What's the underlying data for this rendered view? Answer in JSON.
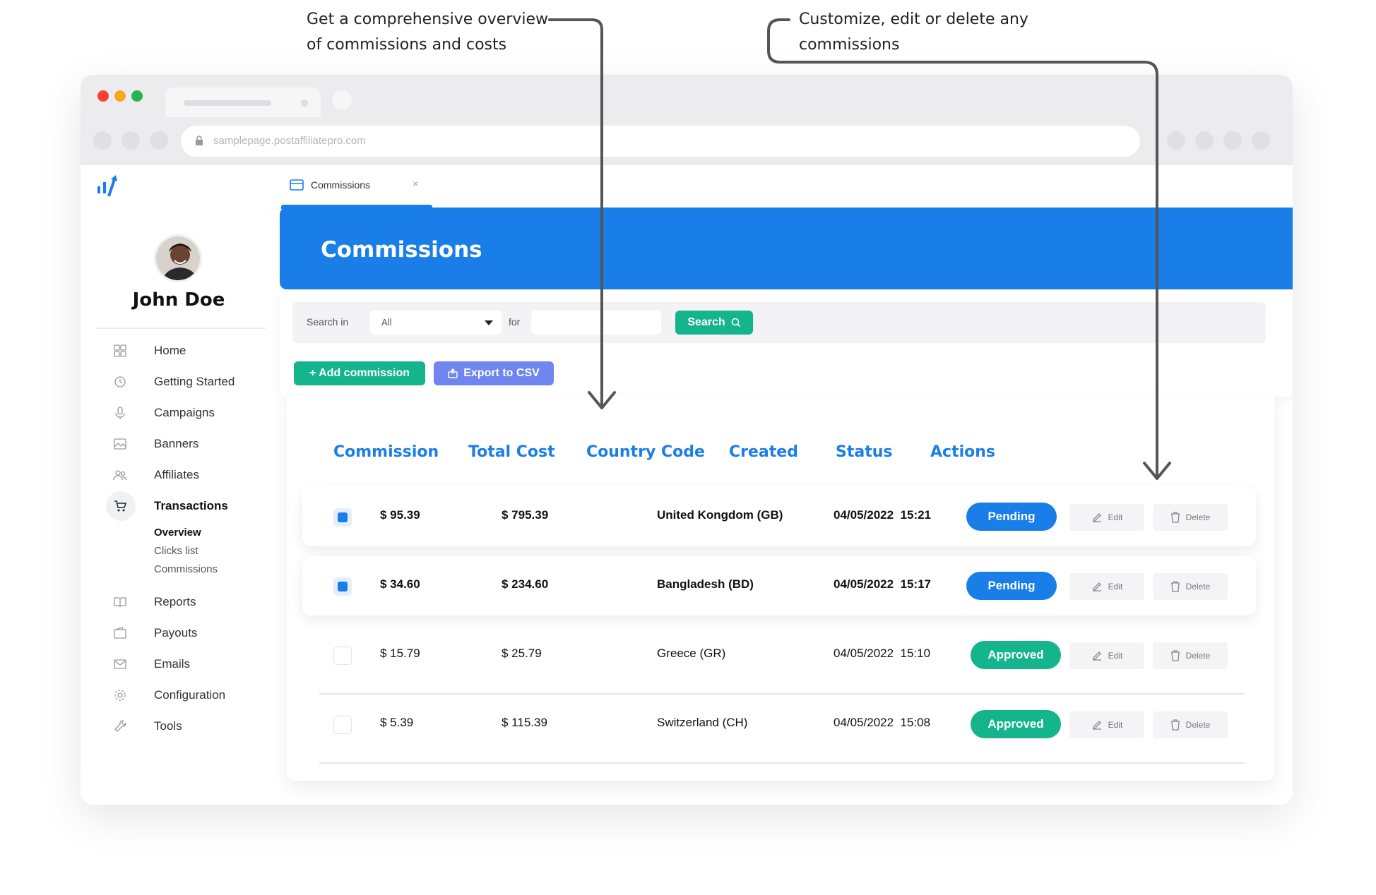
{
  "annotations": {
    "left": "Get a comprehensive overview of commissions and costs",
    "right": "Customize, edit or delete any commissions"
  },
  "browser": {
    "url": "samplepage.postaffiliatepro.com"
  },
  "app": {
    "tab_label": "Commissions",
    "tab_close": "×"
  },
  "user": {
    "name": "John Doe"
  },
  "sidebar": {
    "items": [
      {
        "label": "Home",
        "icon": "grid-icon"
      },
      {
        "label": "Getting Started",
        "icon": "clock-icon"
      },
      {
        "label": "Campaigns",
        "icon": "mic-icon"
      },
      {
        "label": "Banners",
        "icon": "image-icon"
      },
      {
        "label": "Affiliates",
        "icon": "users-icon"
      },
      {
        "label": "Transactions",
        "icon": "cart-icon"
      },
      {
        "label": "Reports",
        "icon": "book-icon"
      },
      {
        "label": "Payouts",
        "icon": "wallet-icon"
      },
      {
        "label": "Emails",
        "icon": "mail-icon"
      },
      {
        "label": "Configuration",
        "icon": "gear-icon"
      },
      {
        "label": "Tools",
        "icon": "wrench-icon"
      }
    ],
    "sub_items": [
      "Overview",
      "Clicks list",
      "Commissions"
    ]
  },
  "page": {
    "title": "Commissions"
  },
  "filter": {
    "search_in_label": "Search in",
    "select_value": "All",
    "for_label": "for",
    "search_button": "Search",
    "add_button": "+ Add commission",
    "export_button": "Export to CSV"
  },
  "table": {
    "headers": [
      "Commission",
      "Total Cost",
      "Country Code",
      "Created",
      "Status",
      "Actions"
    ],
    "rows": [
      {
        "checked": true,
        "commission": "$ 95.39",
        "total": "$ 795.39",
        "country": "United Kongdom (GB)",
        "created": "04/05/2022  15:21",
        "status": "Pending"
      },
      {
        "checked": true,
        "commission": "$ 34.60",
        "total": "$ 234.60",
        "country": "Bangladesh (BD)",
        "created": "04/05/2022  15:17",
        "status": "Pending"
      },
      {
        "checked": false,
        "commission": "$ 15.79",
        "total": "$ 25.79",
        "country": "Greece (GR)",
        "created": "04/05/2022  15:10",
        "status": "Approved"
      },
      {
        "checked": false,
        "commission": "$ 5.39",
        "total": "$ 115.39",
        "country": "Switzerland (CH)",
        "created": "04/05/2022  15:08",
        "status": "Approved"
      }
    ],
    "edit_label": "Edit",
    "delete_label": "Delete"
  },
  "colors": {
    "primary": "#1a7ee8",
    "success": "#14b48c",
    "export": "#6f86f0"
  }
}
